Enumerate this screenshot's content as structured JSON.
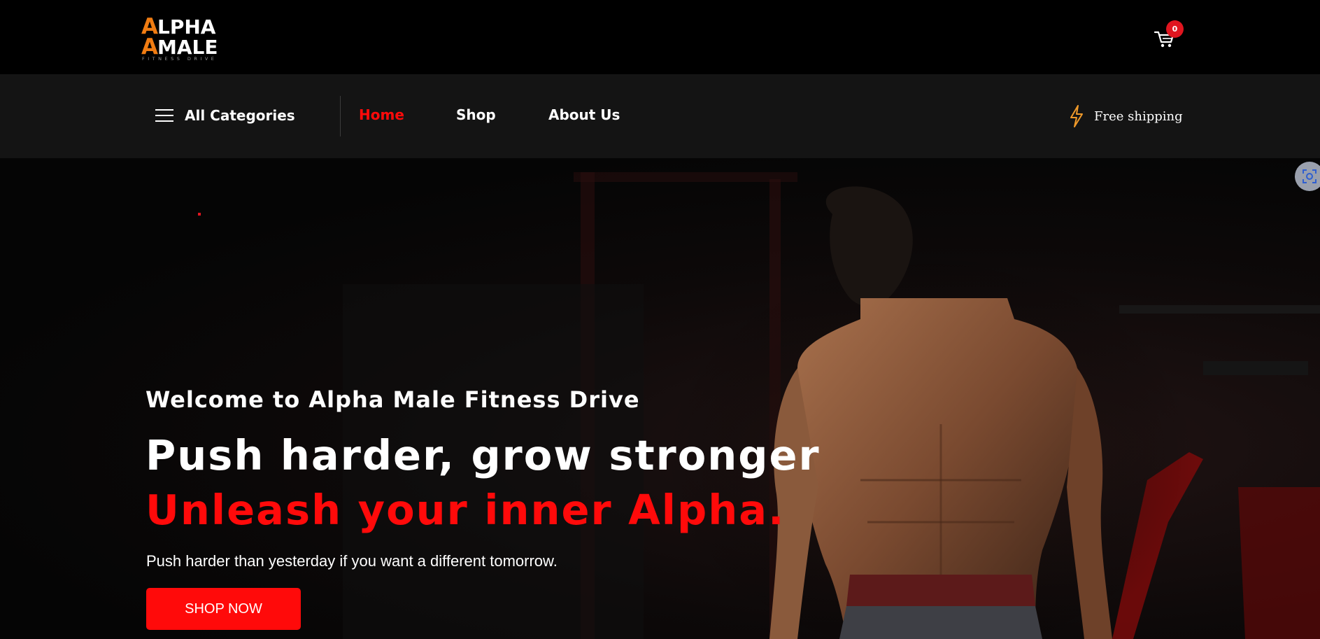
{
  "header": {
    "logo_line1": "ALPHA",
    "logo_line2": "MALE",
    "logo_tagline": "FITNESS DRIVE",
    "cart_count": "0"
  },
  "nav": {
    "categories_label": "All Categories",
    "links": [
      {
        "label": "Home",
        "active": true
      },
      {
        "label": "Shop",
        "active": false
      },
      {
        "label": "About Us",
        "active": false
      }
    ],
    "shipping_label": "Free shipping"
  },
  "hero": {
    "welcome": "Welcome to Alpha Male Fitness Drive",
    "headline": "Push harder, grow stronger",
    "subhead": "Unleash your inner Alpha.",
    "tagline": "Push harder than yesterday if you want a different tomorrow.",
    "cta_label": "SHOP NOW"
  },
  "colors": {
    "accent_red": "#ff0a0a",
    "logo_orange": "#f07c12",
    "shipping_icon": "#f09a2a",
    "nav_bg": "#141414"
  },
  "icons": [
    "hamburger-icon",
    "cart-icon",
    "lightning-icon",
    "lens-icon"
  ]
}
